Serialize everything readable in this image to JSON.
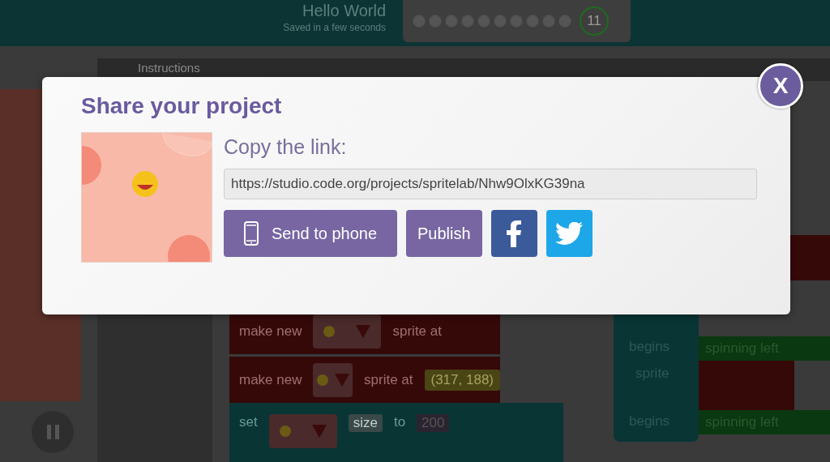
{
  "header": {
    "title": "Hello World",
    "subtitle": "Saved in a few seconds",
    "progress_count": "11"
  },
  "instructions": {
    "label": "Instructions"
  },
  "workspace": {
    "blocks": [
      {
        "kind": "make",
        "label": "make new",
        "suffix": "sprite at"
      },
      {
        "kind": "make",
        "label": "make new",
        "suffix": "sprite at",
        "value": "(317, 188)"
      },
      {
        "kind": "set",
        "label": "set",
        "property": "size",
        "to": "to",
        "value": "200"
      }
    ],
    "event_blocks": [
      {
        "label": "begins",
        "action": "spinning left"
      },
      {
        "label": "sprite"
      },
      {
        "label": "begins",
        "action": "spinning left"
      }
    ]
  },
  "dialog": {
    "title": "Share your project",
    "link_label": "Copy the link:",
    "link_url": "https://studio.code.org/projects/spritelab/Nhw9OlxKG39na",
    "buttons": [
      {
        "kind": "phone",
        "label": "Send to phone"
      },
      {
        "kind": "text",
        "label": "Publish"
      },
      {
        "kind": "facebook"
      },
      {
        "kind": "twitter"
      }
    ],
    "close_label": "X"
  }
}
